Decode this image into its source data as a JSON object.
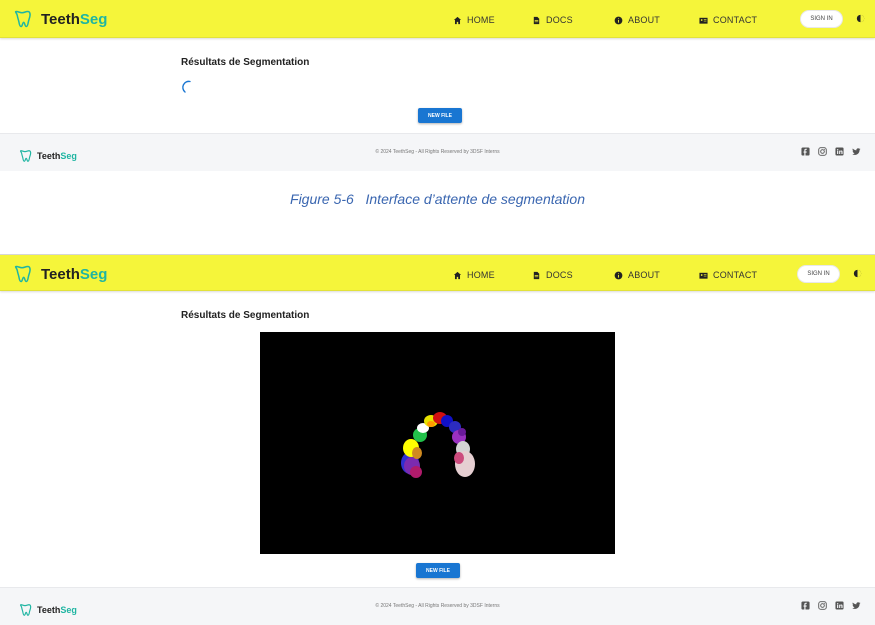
{
  "brand": {
    "name_part1": "Teeth",
    "name_part2": "Seg"
  },
  "nav": {
    "home": "HOME",
    "docs": "DOCS",
    "about": "ABOUT",
    "contact": "CONTACT",
    "signin": "SIGN IN"
  },
  "page": {
    "title": "Résultats de Segmentation",
    "new_file": "NEW FILE"
  },
  "footer": {
    "copyright": "© 2024 TeethSeg - All Rights Reserved by 3DSF Interns",
    "social": [
      "facebook-icon",
      "instagram-icon",
      "linkedin-icon",
      "twitter-icon"
    ]
  },
  "caption": {
    "label": "Figure 5-6",
    "text": "Interface d’attente de segmentation"
  },
  "colors": {
    "navbar": "#f5f53a",
    "accent": "#1fb5a2",
    "button": "#1976d2",
    "caption": "#3a66b0"
  }
}
